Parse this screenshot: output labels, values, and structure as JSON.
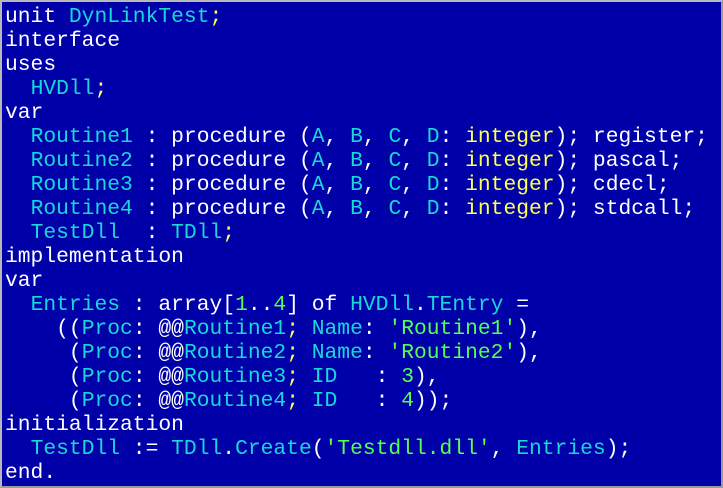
{
  "editor": {
    "colors": {
      "background": "#0000a8",
      "keyword": "#ffffff",
      "identifier": "#18d8d8",
      "symbol": "#ffff54",
      "string": "#54ff54",
      "number": "#54ff54"
    },
    "lines": [
      [
        [
          "kw",
          "unit "
        ],
        [
          "id",
          "DynLinkTest"
        ],
        [
          "sym",
          ";"
        ]
      ],
      [
        [
          "kw",
          "interface"
        ]
      ],
      [
        [
          "kw",
          "uses"
        ]
      ],
      [
        [
          "op",
          "  "
        ],
        [
          "id",
          "HVDll"
        ],
        [
          "sym",
          ";"
        ]
      ],
      [
        [
          "kw",
          "var"
        ]
      ],
      [
        [
          "op",
          "  "
        ],
        [
          "id",
          "Routine1"
        ],
        [
          "op",
          " : procedure ("
        ],
        [
          "id",
          "A"
        ],
        [
          "op",
          ", "
        ],
        [
          "id",
          "B"
        ],
        [
          "op",
          ", "
        ],
        [
          "id",
          "C"
        ],
        [
          "op",
          ", "
        ],
        [
          "id",
          "D"
        ],
        [
          "op",
          ": "
        ],
        [
          "type",
          "integer"
        ],
        [
          "op",
          "); register;"
        ]
      ],
      [
        [
          "op",
          "  "
        ],
        [
          "id",
          "Routine2"
        ],
        [
          "op",
          " : procedure ("
        ],
        [
          "id",
          "A"
        ],
        [
          "op",
          ", "
        ],
        [
          "id",
          "B"
        ],
        [
          "op",
          ", "
        ],
        [
          "id",
          "C"
        ],
        [
          "op",
          ", "
        ],
        [
          "id",
          "D"
        ],
        [
          "op",
          ": "
        ],
        [
          "type",
          "integer"
        ],
        [
          "op",
          "); pascal;"
        ]
      ],
      [
        [
          "op",
          "  "
        ],
        [
          "id",
          "Routine3"
        ],
        [
          "op",
          " : procedure ("
        ],
        [
          "id",
          "A"
        ],
        [
          "op",
          ", "
        ],
        [
          "id",
          "B"
        ],
        [
          "op",
          ", "
        ],
        [
          "id",
          "C"
        ],
        [
          "op",
          ", "
        ],
        [
          "id",
          "D"
        ],
        [
          "op",
          ": "
        ],
        [
          "type",
          "integer"
        ],
        [
          "op",
          "); cdecl;"
        ]
      ],
      [
        [
          "op",
          "  "
        ],
        [
          "id",
          "Routine4"
        ],
        [
          "op",
          " : procedure ("
        ],
        [
          "id",
          "A"
        ],
        [
          "op",
          ", "
        ],
        [
          "id",
          "B"
        ],
        [
          "op",
          ", "
        ],
        [
          "id",
          "C"
        ],
        [
          "op",
          ", "
        ],
        [
          "id",
          "D"
        ],
        [
          "op",
          ": "
        ],
        [
          "type",
          "integer"
        ],
        [
          "op",
          "); stdcall;"
        ]
      ],
      [
        [
          "op",
          "  "
        ],
        [
          "id",
          "TestDll"
        ],
        [
          "op",
          "  : "
        ],
        [
          "id",
          "TDll"
        ],
        [
          "sym",
          ";"
        ]
      ],
      [
        [
          "kw",
          "implementation"
        ]
      ],
      [
        [
          "kw",
          "var"
        ]
      ],
      [
        [
          "op",
          "  "
        ],
        [
          "id",
          "Entries"
        ],
        [
          "op",
          " : array["
        ],
        [
          "num",
          "1"
        ],
        [
          "op",
          ".."
        ],
        [
          "num",
          "4"
        ],
        [
          "op",
          "] of "
        ],
        [
          "id",
          "HVDll"
        ],
        [
          "op",
          "."
        ],
        [
          "id",
          "TEntry"
        ],
        [
          "op",
          " ="
        ]
      ],
      [
        [
          "op",
          "    (("
        ],
        [
          "id",
          "Proc"
        ],
        [
          "op",
          ": @@"
        ],
        [
          "id",
          "Routine1"
        ],
        [
          "sym",
          ";"
        ],
        [
          "op",
          " "
        ],
        [
          "id",
          "Name"
        ],
        [
          "op",
          ": "
        ],
        [
          "str",
          "'Routine1'"
        ],
        [
          "op",
          "),"
        ]
      ],
      [
        [
          "op",
          "     ("
        ],
        [
          "id",
          "Proc"
        ],
        [
          "op",
          ": @@"
        ],
        [
          "id",
          "Routine2"
        ],
        [
          "sym",
          ";"
        ],
        [
          "op",
          " "
        ],
        [
          "id",
          "Name"
        ],
        [
          "op",
          ": "
        ],
        [
          "str",
          "'Routine2'"
        ],
        [
          "op",
          "),"
        ]
      ],
      [
        [
          "op",
          "     ("
        ],
        [
          "id",
          "Proc"
        ],
        [
          "op",
          ": @@"
        ],
        [
          "id",
          "Routine3"
        ],
        [
          "sym",
          ";"
        ],
        [
          "op",
          " "
        ],
        [
          "id",
          "ID"
        ],
        [
          "op",
          "   : "
        ],
        [
          "num",
          "3"
        ],
        [
          "op",
          "),"
        ]
      ],
      [
        [
          "op",
          "     ("
        ],
        [
          "id",
          "Proc"
        ],
        [
          "op",
          ": @@"
        ],
        [
          "id",
          "Routine4"
        ],
        [
          "sym",
          ";"
        ],
        [
          "op",
          " "
        ],
        [
          "id",
          "ID"
        ],
        [
          "op",
          "   : "
        ],
        [
          "num",
          "4"
        ],
        [
          "op",
          "));"
        ]
      ],
      [
        [
          "kw",
          "initialization"
        ]
      ],
      [
        [
          "op",
          "  "
        ],
        [
          "id",
          "TestDll"
        ],
        [
          "op",
          " := "
        ],
        [
          "id",
          "TDll"
        ],
        [
          "op",
          "."
        ],
        [
          "id",
          "Create"
        ],
        [
          "op",
          "("
        ],
        [
          "str",
          "'Testdll.dll'"
        ],
        [
          "op",
          ", "
        ],
        [
          "id",
          "Entries"
        ],
        [
          "op",
          ");"
        ]
      ],
      [
        [
          "kw",
          "end."
        ]
      ]
    ]
  }
}
